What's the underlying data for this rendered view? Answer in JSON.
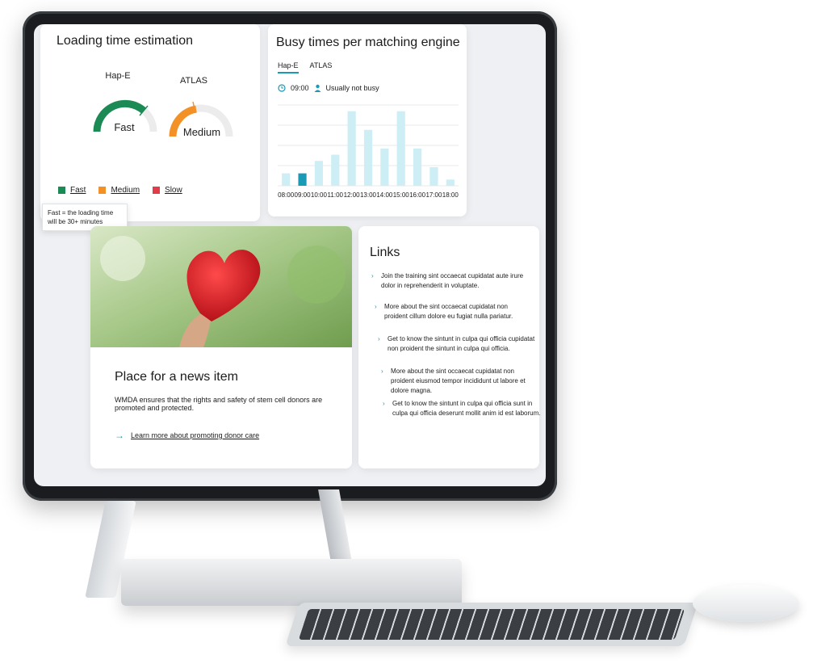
{
  "loading_card": {
    "title": "Loading time estimation",
    "gauges": [
      {
        "engine": "Hap-E",
        "value_label": "Fast",
        "level": 0.65,
        "color": "#1b8a54"
      },
      {
        "engine": "ATLAS",
        "value_label": "Medium",
        "level": 0.45,
        "color": "#f39026"
      }
    ],
    "legend": [
      {
        "label": "Fast",
        "color": "#1b8a54"
      },
      {
        "label": "Medium",
        "color": "#f39026"
      },
      {
        "label": "Slow",
        "color": "#e23b4a"
      }
    ],
    "tooltip": "Fast = the loading time will be 30+ minutes"
  },
  "busy_card": {
    "title": "Busy times per matching engine",
    "tabs": [
      "Hap-E",
      "ATLAS"
    ],
    "active_tab": "Hap-E",
    "status_time": "09:00",
    "status_text": "Usually not busy",
    "chart_data": {
      "type": "bar",
      "categories": [
        "08:00",
        "09:00",
        "10:00",
        "11:00",
        "12:00",
        "13:00",
        "14:00",
        "15:00",
        "16:00",
        "17:00",
        "18:00"
      ],
      "values": [
        2,
        2,
        4,
        5,
        12,
        9,
        6,
        12,
        6,
        3,
        1
      ],
      "ylim": [
        0,
        13
      ],
      "highlight_index": 1,
      "colors": {
        "bar": "#cdeef5",
        "highlight": "#1a9bb5"
      },
      "grid": true
    }
  },
  "news_card": {
    "title": "Place for a news item",
    "text": "WMDA ensures that the rights and safety of stem cell donors are promoted and protected.",
    "link": "Learn more about promoting donor care"
  },
  "links_card": {
    "title": "Links",
    "items": [
      "Join the training sint occaecat cupidatat aute irure dolor in reprehenderit in voluptate.",
      "More about the sint occaecat cupidatat non proident cillum dolore eu fugiat nulla pariatur.",
      "Get to know the sintunt in culpa qui officia cupidatat non proident the sintunt in culpa qui officia.",
      "More about the sint occaecat cupidatat non proident eiusmod tempor incididunt ut labore et dolore magna.",
      "Get to know the sintunt in culpa qui officia sunt in culpa qui officia deserunt mollit anim id est laborum."
    ]
  }
}
